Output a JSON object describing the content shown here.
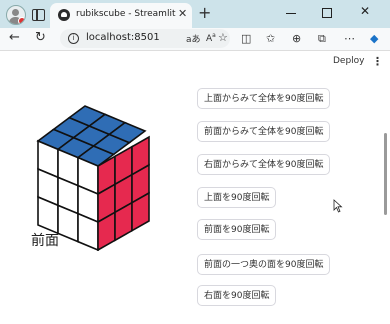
{
  "browser": {
    "tab_title": "rubikscube - Streamlit",
    "url": "localhost:8501"
  },
  "app": {
    "deploy_label": "Deploy",
    "menu_icon": "kebab-menu-icon",
    "face_label": "前面",
    "buttons": [
      "上面からみて全体を90度回転",
      "前面からみて全体を90度回転",
      "右面からみて全体を90度回転",
      "上面を90度回転",
      "前面を90度回転",
      "前面の一つ奥の面を90度回転",
      "右面を90度回転"
    ]
  },
  "cube": {
    "top_color": "#2f6db5",
    "front_color": "#ffffff",
    "right_color": "#e6294f",
    "edge_color": "#111111"
  }
}
